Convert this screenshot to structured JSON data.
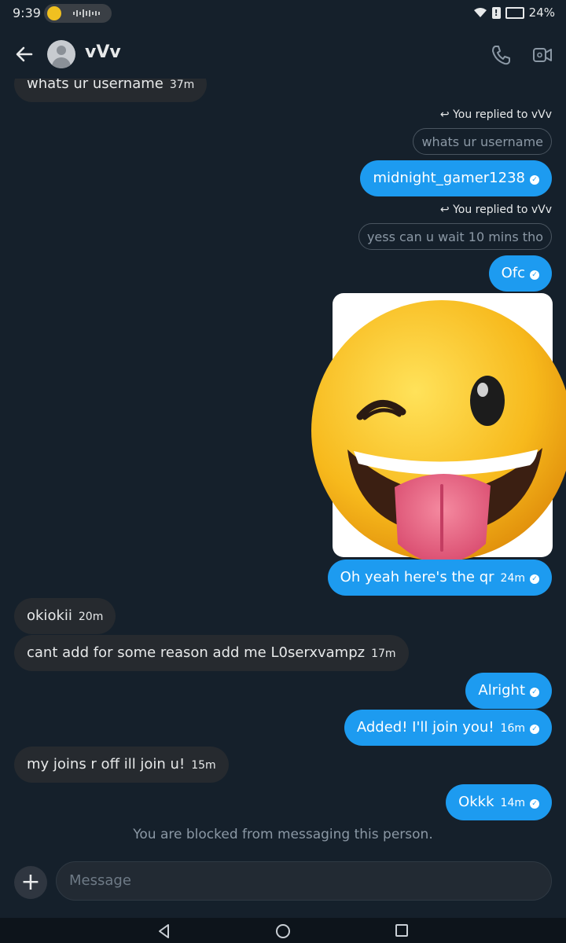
{
  "status_bar": {
    "time": "9:39",
    "battery": "24%"
  },
  "header": {
    "contact_name": "vVv"
  },
  "messages": [
    {
      "text": "whats ur username",
      "time": "37m"
    },
    {
      "replied_label": "You replied to vVv",
      "quoted": "whats ur username",
      "text": "midnight_gamer1238"
    },
    {
      "replied_label": "You replied to vVv",
      "quoted": "yess can u wait 10 mins tho",
      "text": "Ofc"
    },
    {
      "text": "Oh yeah here's the qr",
      "time": "24m"
    },
    {
      "text": "okiokii",
      "time": "20m"
    },
    {
      "text": "cant add for some reason add me L0serxvampz",
      "time": "17m"
    },
    {
      "text": "Alright"
    },
    {
      "text": "Added! I'll join you!",
      "time": "16m"
    },
    {
      "text": "my joins r off ill join u!",
      "time": "15m"
    },
    {
      "text": "Okkk",
      "time": "14m"
    }
  ],
  "blocked_notice": "You are blocked from messaging this person.",
  "composer": {
    "placeholder": "Message"
  },
  "icons": {
    "back": "arrow-left-icon",
    "call": "phone-icon",
    "video": "video-camera-icon",
    "reply": "reply-arrow-icon",
    "sent": "check-circle-icon",
    "add": "plus-icon"
  },
  "colors": {
    "background": "#15202b",
    "outgoing_bubble": "#1d9bf0",
    "incoming_bubble": "#262a2f",
    "muted_text": "#8b98a5"
  }
}
